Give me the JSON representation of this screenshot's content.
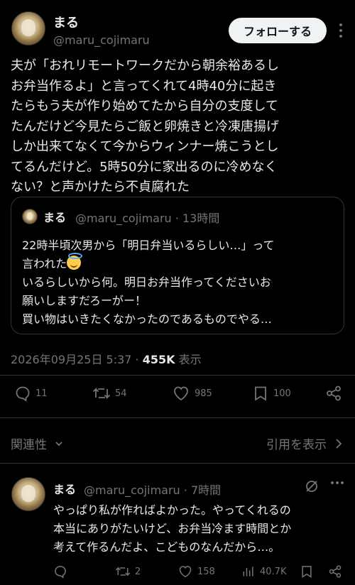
{
  "author": {
    "name": "まる",
    "handle": "@maru_cojimaru",
    "follow_label": "フォローする"
  },
  "post": {
    "text": "夫が「おれリモートワークだから朝余裕あるし\nお弁当作るよ」と言ってくれて4時40分に起き\nたらもう夫が作り始めてたから自分の支度して\nたんだけど今見たらご飯と卵焼きと冷凍唐揚げ\nしか出来てなくて今からウィンナー焼こうとし\nてるんだけど。5時50分に家出るのに冷めなく\nない？と声かけたら不貞腐れた",
    "date": "2026年09月25日 5:37",
    "views_count": "455K",
    "views_label": "表示",
    "stats": {
      "replies": "11",
      "reposts": "54",
      "likes": "985",
      "bookmarks": "100"
    }
  },
  "quote": {
    "name": "まる",
    "handle": "@maru_cojimaru",
    "time": "13時間",
    "line1": "22時半頃次男から「明日弁当いるらしい…」って",
    "line2": "言われた",
    "emoji": "smiling-face-with-halo",
    "line3": "いるらしいから何。明日お弁当作ってくださいお\n願いしますだろーがー！\n買い物はいきたくなかったのであるものでやる…"
  },
  "filters": {
    "relevance_label": "関連性",
    "view_quotes_label": "引用を表示"
  },
  "reply": {
    "name": "まる",
    "handle": "@maru_cojimaru",
    "time": "7時間",
    "text": "やっぱり私が作ればよかった。やってくれるの\n本当にありがたいけど、お弁当冷ます時間とか\n考えて作るんだよ、こどものなんだから…。",
    "stats": {
      "reposts": "2",
      "likes": "158",
      "views": "40.7K"
    }
  },
  "colors": {
    "background": "#000000",
    "text": "#e7e9ea",
    "muted": "#71767b",
    "border": "#2f3336",
    "follow_bg": "#eff3f4"
  }
}
